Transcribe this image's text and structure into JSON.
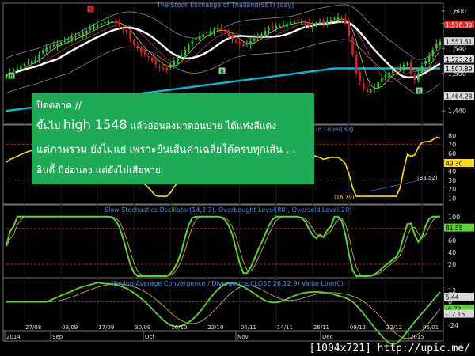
{
  "chart_data": [
    {
      "type": "line",
      "panel": "price",
      "title": "The Stock Exchange of Thailand(SET) [day]",
      "y_ticks": [
        "1,600",
        "1,580",
        "1,540",
        "1,500",
        "1,440"
      ],
      "price_labels": [
        {
          "text": "1,578.39",
          "bg": "#e03030",
          "fg": "#ffffff"
        },
        {
          "text": "1,551.51",
          "bg": "#d8d8d8",
          "fg": "#000000"
        },
        {
          "text": "1,523.24",
          "bg": "#d8d8d8",
          "fg": "#000000"
        },
        {
          "text": "1,507.89",
          "bg": "#d8d8d8",
          "fg": "#000000"
        },
        {
          "text": "1,464.28",
          "bg": "#d8d8d8",
          "fg": "#000000"
        }
      ],
      "signal_markers": [
        "S",
        "B",
        "B",
        "B"
      ],
      "close_series": [
        1496,
        1502,
        1505,
        1508,
        1512,
        1515,
        1518,
        1520,
        1522,
        1530,
        1537,
        1541,
        1543,
        1545,
        1548,
        1550,
        1552,
        1555,
        1558,
        1560,
        1562,
        1565,
        1568,
        1572,
        1575,
        1578,
        1580,
        1582,
        1585,
        1584,
        1580,
        1576,
        1570,
        1566,
        1556,
        1546,
        1540,
        1534,
        1530,
        1526,
        1520,
        1514,
        1510,
        1508,
        1506,
        1514,
        1520,
        1524,
        1531,
        1538,
        1546,
        1552,
        1556,
        1560,
        1563,
        1566,
        1568,
        1570,
        1572,
        1570,
        1566,
        1560,
        1555,
        1550,
        1546,
        1544,
        1548,
        1552,
        1556,
        1560,
        1563,
        1568,
        1572,
        1574,
        1576,
        1576,
        1578,
        1580,
        1582,
        1583,
        1584,
        1582,
        1580,
        1576,
        1578,
        1580,
        1582,
        1580,
        1584,
        1586,
        1588,
        1590,
        1587,
        1580,
        1560,
        1530,
        1500,
        1488,
        1475,
        1470,
        1472,
        1478,
        1486,
        1492,
        1497,
        1502,
        1506,
        1504,
        1508,
        1514,
        1516,
        1500,
        1490,
        1500,
        1512,
        1520,
        1528,
        1538,
        1548,
        1551
      ]
    },
    {
      "type": "line",
      "panel": "rsi",
      "title": "Relative Strength Index (30), Overbought Level(70), Oversold Level(30)",
      "title_visible": "ld Level(30)",
      "y_ticks": [
        "80",
        "70",
        "60",
        "50",
        "40",
        "30",
        "20",
        "10"
      ],
      "last_value": "49.30",
      "annotations": [
        "(33.52)",
        "(16.79)"
      ],
      "overbought": 70,
      "oversold": 30
    },
    {
      "type": "line",
      "panel": "stochastic",
      "title": "Slow Stochastics Oscillator(14,3,3), Overbought Level(80), Oversold Level(20)",
      "y_ticks": [
        "100",
        "80",
        "60",
        "40",
        "20"
      ],
      "last_value": "81.55",
      "overbought": 80,
      "oversold": 20
    },
    {
      "type": "line",
      "panel": "macd",
      "title": "Moving Average Convergence / Divergence(CLOSE,26,12,9) Value Line(0)",
      "y_ticks": [
        "12",
        "6",
        "0",
        "-6",
        "-12",
        "-24"
      ],
      "value_labels": [
        "5.44",
        "-6.72",
        "-12.16"
      ],
      "zero_line": 0
    }
  ],
  "x_axis": {
    "dates": [
      "27/08",
      "08/09",
      "17/09",
      "30/09",
      "10/10",
      "22/10",
      "04/11",
      "14/11",
      "26/11",
      "09/12",
      "22/12",
      "06/01"
    ],
    "months": [
      "2014",
      "Sep",
      "Oct",
      "Nov",
      "Dec",
      "2015"
    ]
  },
  "note": {
    "line1": "ปิดตลาด //",
    "line2a": "ขึ้นไป",
    "line2b": "high 1548",
    "line2c": "แล้วอ่อนลงมาตอนบ่าย ได้แท่งสีแดง",
    "line3": "แต่ภาพรวม ยังไม่แย่ เพราะยืนเส้นค่าเฉลี่ยได้ครบทุกเส้น ...",
    "line4": "อินดี้ มีอ่อนลง แต่ยังไม่เสียหาย"
  },
  "watermark": "[1004x721] http://upic.me/",
  "colors": {
    "up": "#2ecc2e",
    "down": "#e02020",
    "ma_white": "#ffffff",
    "ma_cyan": "#00bcd4",
    "indicator": "#ffe000",
    "stoch": "#5bd62a",
    "note_bg": "#1faa55"
  }
}
